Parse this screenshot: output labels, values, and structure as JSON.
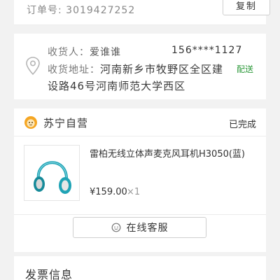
{
  "order": {
    "label": "订单号: 3019427252",
    "copy_label": "复制"
  },
  "address": {
    "receiver_label": "收货人：",
    "receiver_name": "爱谁谁",
    "phone": "156****1127",
    "address_label": "收货地址：",
    "address_text": "河南新乡市牧野区全区建设路46号河南师范大学西区",
    "delivery_mode": "配送"
  },
  "store": {
    "name": "苏宁自营",
    "status": "已完成",
    "logo_icon": "suning-lion-icon",
    "logo_color": "#f5a623"
  },
  "item": {
    "title": "雷柏无线立体声麦克风耳机H3050(蓝)",
    "price": "¥159.00",
    "quantity": "×1",
    "thumbnail_icon": "headphones-icon",
    "accent": "#1fa3b5"
  },
  "service_button": {
    "label": "在线客服",
    "icon": "chat-icon"
  },
  "invoice": {
    "title": "发票信息"
  }
}
